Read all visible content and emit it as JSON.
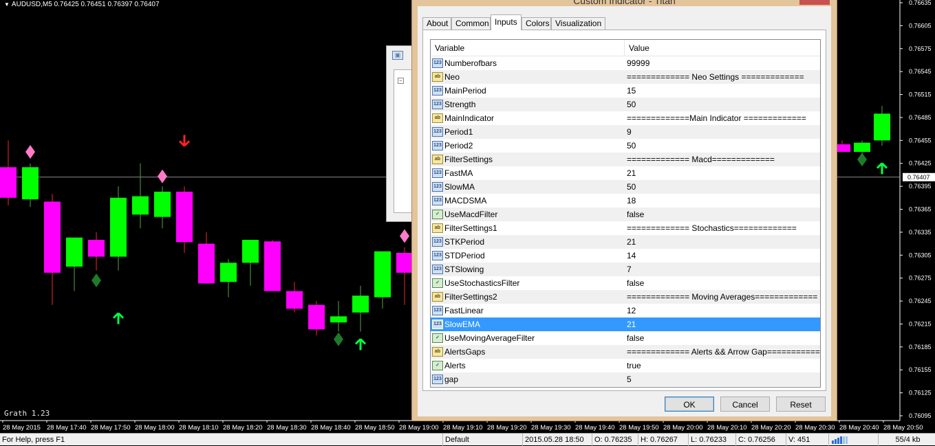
{
  "chart": {
    "title": "AUDUSD,M5  0.76425 0.76451 0.76397 0.76407",
    "indicator_label": "Grath 1.23",
    "current_price": "0.76407",
    "price_ticks": [
      "0.76635",
      "0.76605",
      "0.76575",
      "0.76545",
      "0.76515",
      "0.76485",
      "0.76455",
      "0.76425",
      "0.76395",
      "0.76365",
      "0.76335",
      "0.76305",
      "0.76275",
      "0.76245",
      "0.76215",
      "0.76185",
      "0.76155",
      "0.76125",
      "0.76095"
    ],
    "time_ticks": [
      "28 May 2015",
      "28 May 17:40",
      "28 May 17:50",
      "28 May 18:00",
      "28 May 18:10",
      "28 May 18:20",
      "28 May 18:30",
      "28 May 18:40",
      "28 May 18:50",
      "28 May 19:00",
      "28 May 19:10",
      "28 May 19:20",
      "28 May 19:30",
      "28 May 19:40",
      "28 May 19:50",
      "28 May 20:00",
      "28 May 20:10",
      "28 May 20:20",
      "28 May 20:30",
      "28 May 20:40",
      "28 May 20:50"
    ],
    "colors": {
      "bull": "#00ff00",
      "bear": "#ff00ff",
      "wick": "#cc2222",
      "wick_bull": "#4a8a3a",
      "diamond_pink": "#ff7ac8",
      "diamond_green": "#1f7a2a",
      "arrow_up": "#00ff44",
      "arrow_down": "#ff2222",
      "grid": "#ffffff"
    },
    "candles": [
      {
        "o": 0.7642,
        "h": 0.76455,
        "l": 0.7637,
        "c": 0.7638
      },
      {
        "o": 0.76378,
        "h": 0.76425,
        "l": 0.76368,
        "c": 0.7642
      },
      {
        "o": 0.76375,
        "h": 0.76385,
        "l": 0.7624,
        "c": 0.76282
      },
      {
        "o": 0.7629,
        "h": 0.76325,
        "l": 0.76258,
        "c": 0.76328
      },
      {
        "o": 0.76325,
        "h": 0.76335,
        "l": 0.76285,
        "c": 0.76303
      },
      {
        "o": 0.76303,
        "h": 0.76395,
        "l": 0.76285,
        "c": 0.7638
      },
      {
        "o": 0.76358,
        "h": 0.76425,
        "l": 0.7634,
        "c": 0.76382
      },
      {
        "o": 0.76355,
        "h": 0.76395,
        "l": 0.7634,
        "c": 0.76388
      },
      {
        "o": 0.76388,
        "h": 0.76395,
        "l": 0.76308,
        "c": 0.76322
      },
      {
        "o": 0.7632,
        "h": 0.76335,
        "l": 0.76268,
        "c": 0.76268
      },
      {
        "o": 0.7627,
        "h": 0.763,
        "l": 0.7625,
        "c": 0.76295
      },
      {
        "o": 0.76295,
        "h": 0.76325,
        "l": 0.76265,
        "c": 0.76325
      },
      {
        "o": 0.76323,
        "h": 0.76325,
        "l": 0.76258,
        "c": 0.76258
      },
      {
        "o": 0.76258,
        "h": 0.7627,
        "l": 0.7623,
        "c": 0.76235
      },
      {
        "o": 0.7624,
        "h": 0.76245,
        "l": 0.762,
        "c": 0.76208
      },
      {
        "o": 0.76217,
        "h": 0.76245,
        "l": 0.76205,
        "c": 0.76225
      },
      {
        "o": 0.7623,
        "h": 0.76265,
        "l": 0.76205,
        "c": 0.76252
      },
      {
        "o": 0.7625,
        "h": 0.7631,
        "l": 0.76235,
        "c": 0.7631
      },
      {
        "o": 0.76308,
        "h": 0.76315,
        "l": 0.7624,
        "c": 0.76282
      }
    ],
    "right_candles": [
      {
        "o": 0.7645,
        "h": 0.76455,
        "l": 0.7644,
        "c": 0.7644
      },
      {
        "o": 0.7644,
        "h": 0.76455,
        "l": 0.76438,
        "c": 0.76452
      },
      {
        "o": 0.76455,
        "h": 0.765,
        "l": 0.76448,
        "c": 0.7649
      }
    ],
    "signals": [
      {
        "type": "diamond_pink",
        "index": 1,
        "price": 0.7644
      },
      {
        "type": "arrow_down",
        "index": 8,
        "price": 0.76455
      },
      {
        "type": "diamond_pink",
        "index": 7,
        "price": 0.76408
      },
      {
        "type": "diamond_green",
        "index": 4,
        "price": 0.76272
      },
      {
        "type": "arrow_up",
        "index": 5,
        "price": 0.76222
      },
      {
        "type": "diamond_pink",
        "index": 18,
        "price": 0.7633
      },
      {
        "type": "diamond_green",
        "index": 15,
        "price": 0.76195
      },
      {
        "type": "arrow_up",
        "index": 16,
        "price": 0.76188
      },
      {
        "type": "diamond_green",
        "right_index": 1,
        "price": 0.7643
      },
      {
        "type": "arrow_up",
        "right_index": 2,
        "price": 0.76418
      }
    ]
  },
  "dialog": {
    "title": "Custom Indicator - Titan",
    "close_label": "✕",
    "tabs": [
      "About",
      "Common",
      "Inputs",
      "Colors",
      "Visualization"
    ],
    "active_tab": "Inputs",
    "columns": {
      "variable": "Variable",
      "value": "Value"
    },
    "rows": [
      {
        "type": "int",
        "name": "Numberofbars",
        "value": "99999"
      },
      {
        "type": "str",
        "name": "Neo",
        "value": "============= Neo Settings ============="
      },
      {
        "type": "int",
        "name": "MainPeriod",
        "value": "15"
      },
      {
        "type": "int",
        "name": "Strength",
        "value": "50"
      },
      {
        "type": "str",
        "name": "MainIndicator",
        "value": "=============Main Indicator ============="
      },
      {
        "type": "int",
        "name": "Period1",
        "value": "9"
      },
      {
        "type": "int",
        "name": "Period2",
        "value": "50"
      },
      {
        "type": "str",
        "name": "FilterSettings",
        "value": "============= Macd============="
      },
      {
        "type": "int",
        "name": "FastMA",
        "value": "21"
      },
      {
        "type": "int",
        "name": "SlowMA",
        "value": "50"
      },
      {
        "type": "int",
        "name": "MACDSMA",
        "value": "18"
      },
      {
        "type": "bool",
        "name": "UseMacdFilter",
        "value": "false"
      },
      {
        "type": "str",
        "name": "FilterSettings1",
        "value": "============= Stochastics============="
      },
      {
        "type": "int",
        "name": "STKPeriod",
        "value": "21"
      },
      {
        "type": "int",
        "name": "STDPeriod",
        "value": "14"
      },
      {
        "type": "int",
        "name": "STSlowing",
        "value": "7"
      },
      {
        "type": "bool",
        "name": "UseStochasticsFilter",
        "value": "false"
      },
      {
        "type": "str",
        "name": "FilterSettings2",
        "value": "============= Moving Averages============="
      },
      {
        "type": "int",
        "name": "FastLinear",
        "value": "12"
      },
      {
        "type": "int",
        "name": "SlowEMA",
        "value": "21",
        "selected": true
      },
      {
        "type": "bool",
        "name": "UseMovingAverageFilter",
        "value": "false"
      },
      {
        "type": "str",
        "name": "AlertsGaps",
        "value": "============= Alerts && Arrow Gap============="
      },
      {
        "type": "bool",
        "name": "Alerts",
        "value": "true"
      },
      {
        "type": "int",
        "name": "gap",
        "value": "5"
      }
    ],
    "type_icon_text": {
      "int": "123",
      "str": "ab",
      "bool": "✓"
    },
    "buttons": {
      "ok": "OK",
      "cancel": "Cancel",
      "reset": "Reset"
    }
  },
  "statusbar": {
    "help": "For Help, press F1",
    "profile": "Default",
    "datetime": "2015.05.28 18:50",
    "open": "O: 0.76235",
    "high": "H: 0.76267",
    "low": "L: 0.76233",
    "close": "C: 0.76256",
    "volume": "V: 451",
    "traffic": "55/4 kb"
  }
}
